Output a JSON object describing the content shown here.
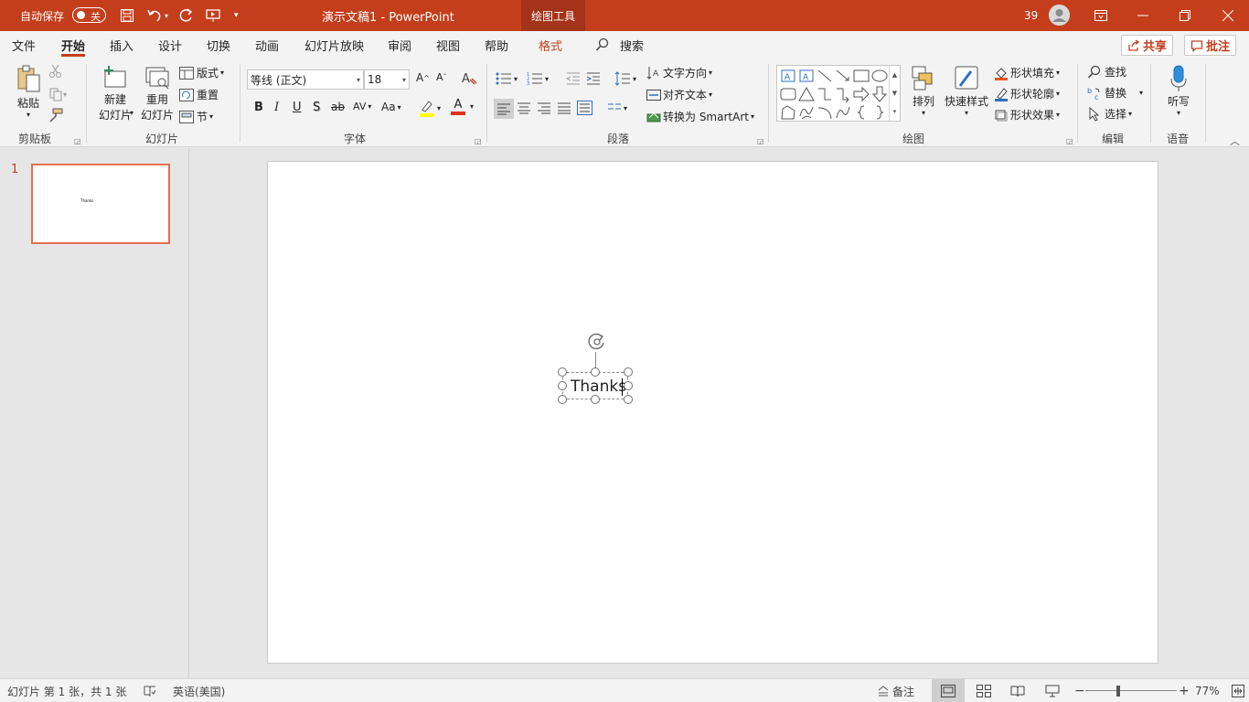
{
  "titlebar": {
    "autosave_label": "自动保存",
    "autosave_state": "关",
    "doc_title": "演示文稿1  -  PowerPoint",
    "contextual_tab": "绘图工具",
    "count": "39",
    "colors": {
      "background": "#c43e1c",
      "contextual": "#a33319"
    }
  },
  "tabs": {
    "file": "文件",
    "home": "开始",
    "insert": "插入",
    "design": "设计",
    "transitions": "切换",
    "animations": "动画",
    "slideshow": "幻灯片放映",
    "review": "审阅",
    "view": "视图",
    "help": "帮助",
    "format": "格式",
    "search": "搜索"
  },
  "actions": {
    "share": "共享",
    "comments": "批注"
  },
  "ribbon": {
    "clipboard": {
      "paste": "粘贴",
      "group": "剪贴板"
    },
    "slides": {
      "new_slide_1": "新建",
      "new_slide_2": "幻灯片",
      "reuse_1": "重用",
      "reuse_2": "幻灯片",
      "layout": "版式",
      "reset": "重置",
      "section": "节",
      "group": "幻灯片"
    },
    "font": {
      "font_name": "等线 (正文)",
      "font_size": "18",
      "bold": "B",
      "italic": "I",
      "underline": "U",
      "shadow": "S",
      "strike": "ab",
      "spacing": "AV",
      "case": "Aa",
      "font_color": "A",
      "grow": "A",
      "shrink": "A",
      "group": "字体"
    },
    "paragraph": {
      "text_direction": "文字方向",
      "align_text": "对齐文本",
      "smartart": "转换为 SmartArt",
      "group": "段落"
    },
    "drawing": {
      "arrange": "排列",
      "quick_styles": "快速样式",
      "fill": "形状填充",
      "outline": "形状轮廓",
      "effects": "形状效果",
      "group": "绘图"
    },
    "editing": {
      "find": "查找",
      "replace": "替换",
      "select": "选择",
      "group": "编辑"
    },
    "voice": {
      "dictate": "听写",
      "group": "语音"
    }
  },
  "slides_pane": {
    "slide_number": "1",
    "thumb_text": "Thanks"
  },
  "slide": {
    "textbox_text": "Thanks"
  },
  "statusbar": {
    "slide_info": "幻灯片 第 1 张，共 1 张",
    "language": "英语(美国)",
    "notes": "备注",
    "zoom": "77%",
    "zoom_level_percent": 77
  }
}
